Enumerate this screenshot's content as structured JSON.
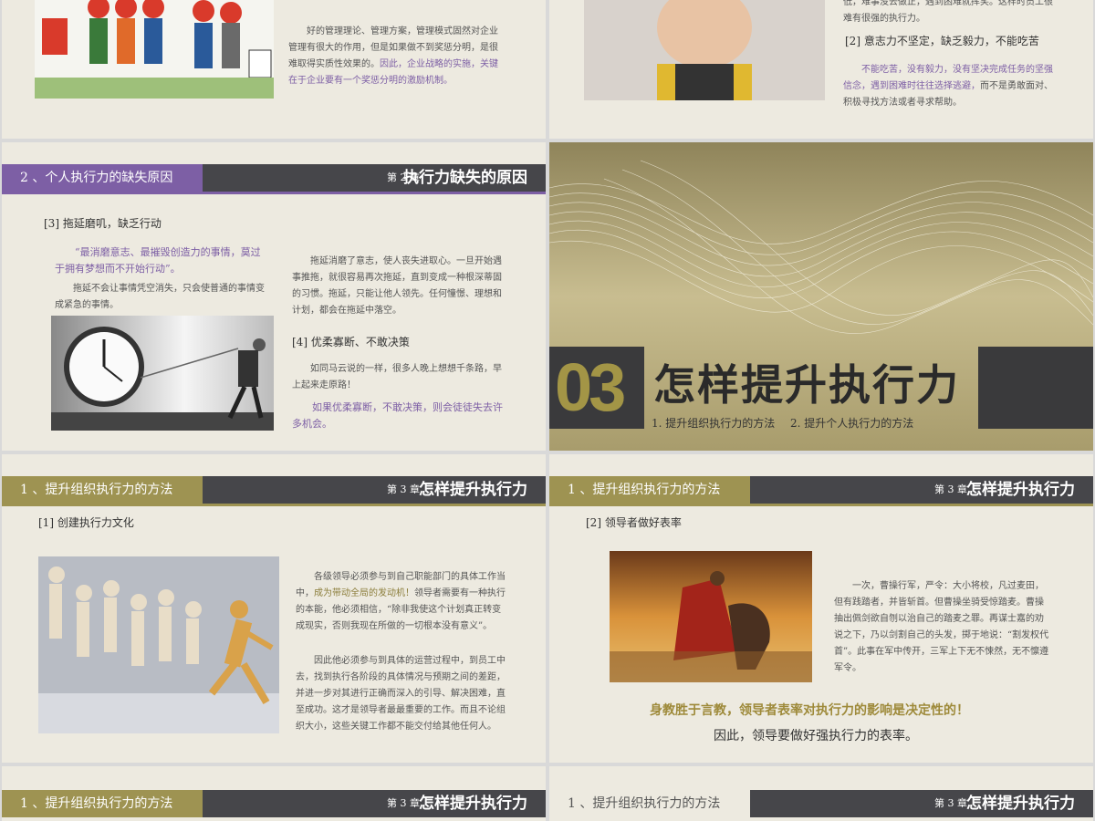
{
  "colors": {
    "purple": "#7d5fa5",
    "gold": "#9e9352",
    "dark": "#46464a",
    "bg": "#edeae0"
  },
  "slide1": {
    "para1": "好的管理理论、管理方案，管理模式固然对企业管理有很大的作用，但是如果做不到奖惩分明，是很难取得实质性效果的。",
    "para1_highlight": "因此，企业战略的实施，关键在于企业要有一个奖惩分明的激励机制。"
  },
  "slide2": {
    "top_text": "低，难事没去做正，遇到困难就挥笑。这样时员工很难有很强的执行力。",
    "heading": "[2]  意志力不坚定，缺乏毅力，不能吃苦",
    "para_highlight": "不能吃苦，没有毅力，没有坚决完成任务的坚强信念，遇到困难时往往选择逃避，",
    "para_rest": "而不是勇敢面对、积极寻找方法或者寻求帮助。"
  },
  "slide3": {
    "header_left": "2 、个人执行力的缺失原因",
    "chapter": "第 2 章",
    "header_title": "执行力缺失的原因",
    "heading3": "[3]  拖延磨叽，缺乏行动",
    "quote": "“最消磨意志、最摧毁创造力的事情，莫过于拥有梦想而不开始行动”。",
    "para_a": "拖延不会让事情凭空消失，只会使普通的事情变成紧急的事情。",
    "para_b": "拖延消磨了意志，使人丧失进取心。一旦开始遇事推拖，就很容易再次拖延，直到变成一种根深蒂固的习惯。拖延，只能让他人领先。任何憧憬、理想和计划，都会在拖延中落空。",
    "heading4": "[4]  优柔寡断、不敢决策",
    "para_c": "如同马云说的一样，很多人晚上想想千条路，早上起来走原路！",
    "para_d": "如果优柔寡断，不敢决策，则会徒徒失去许多机会。"
  },
  "slide4": {
    "number": "03",
    "title": "怎样提升执行力",
    "sub1": "1. 提升组织执行力的方法",
    "sub2": "2. 提升个人执行力的方法"
  },
  "slide5": {
    "header_left": "1 、提升组织执行力的方法",
    "chapter": "第 3 章",
    "header_title": "怎样提升执行力",
    "heading": "[1]  创建执行力文化",
    "p1_a": "各级领导必须参与到自己职能部门的具体工作当中，",
    "p1_hl": "成为带动全局的发动机！",
    "p1_b": "领导者需要有一种执行的本能，他必须相信，“除非我使这个计划真正转变成现实，否则我现在所做的一切根本没有意义”。",
    "p2": "因此他必须参与到具体的运营过程中，到员工中去，找到执行各阶段的具体情况与预期之间的差距，并进一步对其进行正确而深入的引导、解决困难，直至成功。这才是领导者最最重要的工作。而且不论组织大小，这些关键工作都不能交付给其他任何人。"
  },
  "slide6": {
    "header_left": "1 、提升组织执行力的方法",
    "chapter": "第 3 章",
    "header_title": "怎样提升执行力",
    "heading": "[2]  领导者做好表率",
    "para": "一次，曹操行军，严令：大小将校，凡过麦田，但有践踏者，并皆斩首。但曹操坐骑受惊踏麦。曹操抽出佩剑欲自刎以治自己的踏麦之罪。再谋士嘉的劝说之下，乃以剑割自己的头发，掷于地说：“割发权代首”。此事在军中传开，三军上下无不悚然，无不懔遵军令。",
    "line1": "身教胜于言教，领导者表率对执行力的影响是决定性的！",
    "line2": "因此，领导要做好强执行力的表率。"
  },
  "slide7": {
    "header_left": "1 、提升组织执行力的方法",
    "chapter": "第 3 章",
    "header_title": "怎样提升执行力"
  },
  "slide8": {
    "header_left": "1 、提升组织执行力的方法",
    "chapter": "第 3 章",
    "header_title": "怎样提升执行力"
  }
}
